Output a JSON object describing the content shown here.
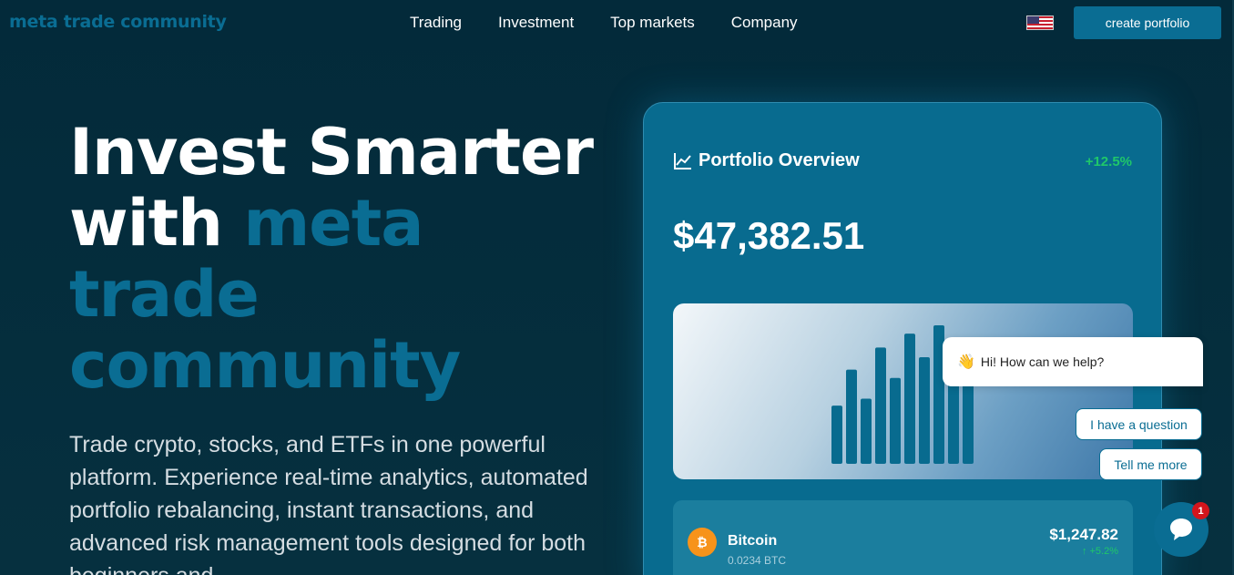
{
  "header": {
    "logo": "meta trade community",
    "nav": [
      "Trading",
      "Investment",
      "Top markets",
      "Company"
    ],
    "cta": "create portfolio",
    "language_icon": "us-flag-icon"
  },
  "hero": {
    "title_line1": "Invest Smarter",
    "title_line2_prefix": "with ",
    "title_accent": [
      "meta",
      "trade",
      "community"
    ],
    "subtitle": "Trade crypto, stocks, and ETFs in one powerful platform. Experience real-time analytics, automated portfolio rebalancing, instant transactions, and advanced risk management tools designed for both beginners and"
  },
  "portfolio": {
    "title": "Portfolio Overview",
    "change": "+12.5%",
    "value": "$47,382.51",
    "bar_levels": [
      0.42,
      0.68,
      0.47,
      0.84,
      0.62,
      0.94,
      0.77,
      1.0,
      0.87,
      0.89
    ],
    "asset": {
      "icon": "bitcoin-icon",
      "symbol": "₿",
      "name": "Bitcoin",
      "quantity": "0.0234 BTC",
      "price": "$1,247.82",
      "delta": "+5.2%"
    }
  },
  "chat": {
    "greeting": "Hi! How can we help?",
    "wave": "👋",
    "options": [
      "I have a question",
      "Tell me more"
    ],
    "badge": "1"
  },
  "colors": {
    "background": "#032a3a",
    "accent": "#0a6d93",
    "positive": "#1fc76a",
    "card": "#086b8f"
  }
}
